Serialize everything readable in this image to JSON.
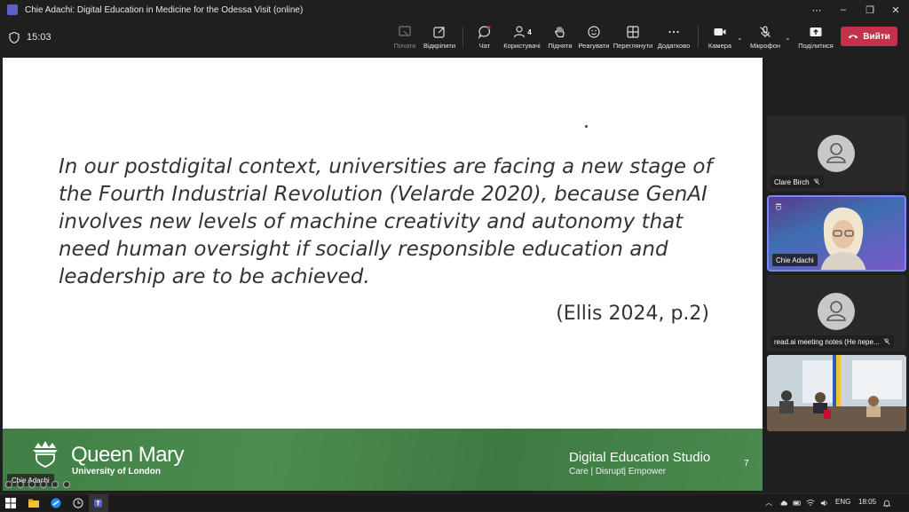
{
  "window": {
    "title": "Chie Adachi: Digital Education in Medicine for the Odessa Visit (online)",
    "controls": [
      "⋯",
      "–",
      "❐",
      "✕"
    ]
  },
  "toolbar": {
    "timer": "15:03",
    "buttons": [
      {
        "id": "present",
        "label": "Почати",
        "icon": "present-icon",
        "disabled": true
      },
      {
        "id": "popout",
        "label": "Відкріпити",
        "icon": "popout-icon"
      },
      {
        "id": "chat",
        "label": "Чат",
        "icon": "chat-icon"
      },
      {
        "id": "people",
        "label": "Користувачі",
        "icon": "people-icon",
        "badge": "4"
      },
      {
        "id": "raise",
        "label": "Підняти",
        "icon": "hand-icon"
      },
      {
        "id": "react",
        "label": "Реагувати",
        "icon": "emoji-icon"
      },
      {
        "id": "view",
        "label": "Переглянути",
        "icon": "grid-icon"
      },
      {
        "id": "more",
        "label": "Додатково",
        "icon": "more-icon"
      },
      {
        "id": "camera",
        "label": "Камера",
        "icon": "camera-icon"
      },
      {
        "id": "mic",
        "label": "Мікрофон",
        "icon": "mic-off-icon"
      },
      {
        "id": "share",
        "label": "Поділитися",
        "icon": "share-icon"
      }
    ],
    "leave_label": "Вийти",
    "colors": {
      "leave": "#c4314b",
      "accent": "#7f85f5"
    }
  },
  "slide": {
    "quote": "In our postdigital context, universities are facing a new stage of the Fourth Industrial Revolution (Velarde 2020), because GenAI involves new levels of machine creativity and autonomy that need human oversight if socially responsible education and leadership are to be achieved.",
    "citation": "(Ellis 2024, p.2)",
    "brand_name": "Queen Mary",
    "brand_sub": "University of London",
    "studio_name": "Digital Education Studio",
    "studio_tagline": "Care | Disrupt| Empower",
    "page_number": "7",
    "footer_color": "#3f7f45"
  },
  "presenter_label": "Chie Adachi",
  "participants": [
    {
      "name": "Clare Birch",
      "muted": true,
      "video": false
    },
    {
      "name": "Chie Adachi",
      "muted": false,
      "video": true,
      "active_speaker": true
    },
    {
      "name": "read.ai meeting notes (Не пере...",
      "muted": true,
      "video": false
    },
    {
      "name": "",
      "muted": false,
      "video": true
    }
  ],
  "taskbar": {
    "language": "ENG",
    "clock": "18:05"
  }
}
